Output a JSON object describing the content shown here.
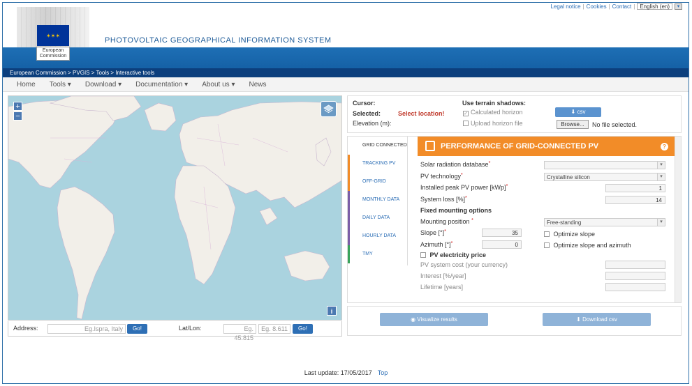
{
  "top_links": {
    "legal": "Legal notice",
    "cookies": "Cookies",
    "contact": "Contact",
    "language": "English (en)"
  },
  "header": {
    "logo_text": "European Commission",
    "app_title": "PHOTOVOLTAIC GEOGRAPHICAL INFORMATION SYSTEM"
  },
  "breadcrumb": "European Commission > PVGIS > Tools > Interactive tools",
  "nav": {
    "items": [
      {
        "label": "Home"
      },
      {
        "label": "Tools ▾"
      },
      {
        "label": "Download ▾"
      },
      {
        "label": "Documentation ▾"
      },
      {
        "label": "About us ▾"
      },
      {
        "label": "News"
      }
    ]
  },
  "map": {
    "zoom_in": "+",
    "zoom_out": "−",
    "info": "i"
  },
  "address_bar": {
    "address_label": "Address:",
    "address_placeholder": "Eg.Ispra, Italy",
    "go": "Go!",
    "latlon_label": "Lat/Lon:",
    "lat_placeholder": "Eg. 45.815",
    "lon_placeholder": "Eg. 8.611"
  },
  "cursor_panel": {
    "cursor_label": "Cursor:",
    "selected_label": "Selected:",
    "selected_value": "Select location!",
    "elevation_label": "Elevation (m):",
    "terrain_title": "Use terrain shadows:",
    "calculated_horizon": "Calculated horizon",
    "upload_horizon": "Upload horizon file",
    "csv_button": "csv",
    "browse_button": "Browse...",
    "no_file": "No file selected."
  },
  "tabs": [
    {
      "label": "GRID CONNECTED",
      "color": "#ffffff"
    },
    {
      "label": "TRACKING PV",
      "color": "#f28c28"
    },
    {
      "label": "OFF-GRID",
      "color": "#f28c28"
    },
    {
      "label": "MONTHLY DATA",
      "color": "#7b5ea7"
    },
    {
      "label": "DAILY DATA",
      "color": "#7b5ea7"
    },
    {
      "label": "HOURLY DATA",
      "color": "#7b5ea7"
    },
    {
      "label": "TMY",
      "color": "#3aa35b"
    }
  ],
  "panel": {
    "title": "PERFORMANCE OF GRID-CONNECTED PV",
    "help": "?",
    "solar_db_label": "Solar radiation database",
    "solar_db_value": "",
    "pv_tech_label": "PV technology",
    "pv_tech_value": "Crystalline silicon",
    "peak_power_label": "Installed peak PV power [kWp]",
    "peak_power_value": "1",
    "system_loss_label": "System loss [%]",
    "system_loss_value": "14",
    "fixed_mounting_title": "Fixed mounting options",
    "mounting_pos_label": "Mounting position",
    "mounting_pos_value": "Free-standing",
    "slope_label": "Slope [°]",
    "slope_value": "35",
    "azimuth_label": "Azimuth [°]",
    "azimuth_value": "0",
    "optimize_slope": "Optimize slope",
    "optimize_slope_azimuth": "Optimize slope and azimuth",
    "pv_price_label": "PV electricity price",
    "system_cost_label": "PV system cost (your currency)",
    "interest_label": "Interest [%/year]",
    "lifetime_label": "Lifetime [years]",
    "required_mark": "*"
  },
  "actions": {
    "visualize": "Visualize results",
    "download_csv": "Download csv"
  },
  "footer": {
    "last_update": "Last update: 17/05/2017",
    "top_link": "Top"
  }
}
